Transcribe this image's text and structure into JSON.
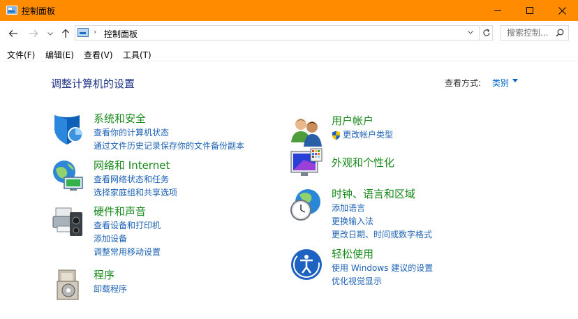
{
  "window": {
    "title": "控制面板",
    "accent": "#ff8c00"
  },
  "address": {
    "path": "控制面板",
    "search_placeholder": "搜索控制... "
  },
  "menu": [
    "文件(F)",
    "编辑(E)",
    "查看(V)",
    "工具(T)"
  ],
  "page": {
    "title": "调整计算机的设置",
    "view_by_label": "查看方式:",
    "view_by_value": "类别"
  },
  "categories": [
    {
      "title": "系统和安全",
      "icon": "system-security-icon",
      "links": [
        "查看你的计算机状态",
        "通过文件历史记录保存你的文件备份副本"
      ]
    },
    {
      "title": "网络和 Internet",
      "icon": "network-icon",
      "links": [
        "查看网络状态和任务",
        "选择家庭组和共享选项"
      ]
    },
    {
      "title": "硬件和声音",
      "icon": "hardware-sound-icon",
      "links": [
        "查看设备和打印机",
        "添加设备",
        "调整常用移动设置"
      ]
    },
    {
      "title": "程序",
      "icon": "programs-icon",
      "links": [
        "卸载程序"
      ]
    },
    {
      "title": "用户帐户",
      "icon": "user-accounts-icon",
      "links": [
        "更改帐户类型"
      ]
    },
    {
      "title": "外观和个性化",
      "icon": "appearance-icon",
      "links": []
    },
    {
      "title": "时钟、语言和区域",
      "icon": "clock-region-icon",
      "links": [
        "添加语言",
        "更换输入法",
        "更改日期、时间或数字格式"
      ]
    },
    {
      "title": "轻松使用",
      "icon": "ease-of-access-icon",
      "links": [
        "使用 Windows 建议的设置",
        "优化视觉显示"
      ]
    }
  ],
  "colors": {
    "category_title": "#188a1c",
    "link": "#1c62b4",
    "page_title": "#1e3287"
  }
}
